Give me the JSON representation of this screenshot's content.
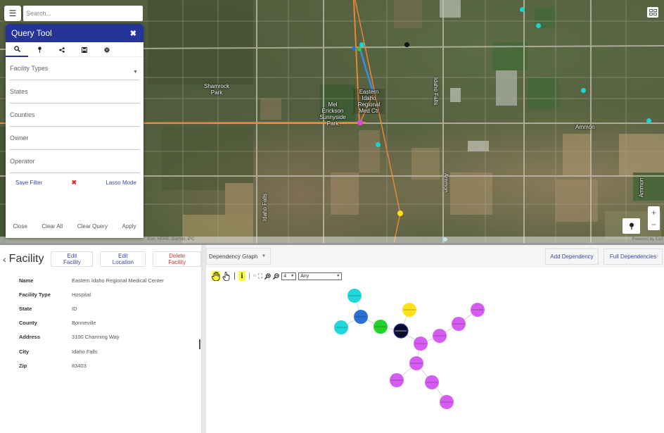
{
  "map": {
    "search_placeholder": "Search...",
    "labels": [
      {
        "id": "shamrock-park",
        "text": "Shamrock Park"
      },
      {
        "id": "mel-erickson-park",
        "text": "Mel Erickson Sunnyside Park"
      },
      {
        "id": "hospital-label",
        "text": "Eastern Idaho Regional Med Ctr"
      },
      {
        "id": "idaho-falls-1",
        "text": "Idaho Falls"
      },
      {
        "id": "idaho-falls-2",
        "text": "Idaho Falls"
      },
      {
        "id": "ammon-1",
        "text": "Ammon"
      },
      {
        "id": "ammon-2",
        "text": "Ammon"
      },
      {
        "id": "ammon-3",
        "text": "Ammon"
      }
    ],
    "attribution_left": "Esri, HERE, Garmin, iPC",
    "attribution_right": "Powered by Esri",
    "zoom_in": "+",
    "zoom_out": "−",
    "colors": {
      "route_orange": "#e8873a",
      "route_blue": "#3a8ee8",
      "marker_cyan": "#19d3d8",
      "marker_magenta": "#d44fe0",
      "marker_yellow": "#ffe11a"
    }
  },
  "query_tool": {
    "title": "Query Tool",
    "tabs": [
      {
        "name": "search",
        "icon": "search-icon"
      },
      {
        "name": "location",
        "icon": "pin-icon"
      },
      {
        "name": "share",
        "icon": "share-icon"
      },
      {
        "name": "save",
        "icon": "save-icon"
      },
      {
        "name": "settings",
        "icon": "gear-icon"
      }
    ],
    "fields": [
      {
        "label": "Facility Types",
        "has_dropdown": true
      },
      {
        "label": "States"
      },
      {
        "label": "Counties"
      },
      {
        "label": "Owner"
      },
      {
        "label": "Operator"
      }
    ],
    "save_filter": "Save Filter",
    "lasso_mode": "Lasso Mode",
    "footer": {
      "close": "Close",
      "clear_all": "Clear All",
      "clear_query": "Clear Query",
      "apply": "Apply"
    }
  },
  "facility": {
    "title": "Facility",
    "edit_facility": "Edit Facility",
    "edit_location": "Edit Location",
    "delete_facility": "Delete Facility",
    "rows": [
      {
        "key": "Name",
        "value": "Eastern Idaho Regional Medical Center"
      },
      {
        "key": "Facility Type",
        "value": "Hospital"
      },
      {
        "key": "State",
        "value": "ID"
      },
      {
        "key": "County",
        "value": "Bonneville"
      },
      {
        "key": "Address",
        "value": "3100 Channing Way"
      },
      {
        "key": "City",
        "value": "Idaho Falls"
      },
      {
        "key": "Zip",
        "value": "83403"
      }
    ]
  },
  "dependency": {
    "view_select": "Dependency Graph",
    "add_dependency": "Add Dependency",
    "full_dependencies": "Full Dependencies",
    "toolbar": {
      "depth_value": "4",
      "filter_value": "Any"
    },
    "graph": {
      "nodes": [
        {
          "id": "n1",
          "color": "#1ed8dc"
        },
        {
          "id": "n2",
          "color": "#2a6fd6"
        },
        {
          "id": "n3",
          "color": "#1ed8dc"
        },
        {
          "id": "n4",
          "color": "#27d12b"
        },
        {
          "id": "n5",
          "color": "#0a0a2a"
        },
        {
          "id": "n6",
          "color": "#ffe21c"
        },
        {
          "id": "n7",
          "color": "#d55cf0"
        },
        {
          "id": "n8",
          "color": "#d55cf0"
        },
        {
          "id": "n9",
          "color": "#d55cf0"
        },
        {
          "id": "n10",
          "color": "#d55cf0"
        },
        {
          "id": "n11",
          "color": "#d55cf0"
        },
        {
          "id": "n12",
          "color": "#d55cf0"
        },
        {
          "id": "n13",
          "color": "#d55cf0"
        },
        {
          "id": "n14",
          "color": "#d55cf0"
        }
      ],
      "edges": [
        [
          "n1",
          "n2"
        ],
        [
          "n3",
          "n2"
        ],
        [
          "n2",
          "n4"
        ],
        [
          "n4",
          "n5"
        ],
        [
          "n6",
          "n5"
        ],
        [
          "n5",
          "n7"
        ],
        [
          "n7",
          "n8"
        ],
        [
          "n8",
          "n9"
        ],
        [
          "n9",
          "n10"
        ],
        [
          "n7",
          "n11"
        ],
        [
          "n11",
          "n12"
        ],
        [
          "n11",
          "n13"
        ],
        [
          "n13",
          "n14"
        ]
      ]
    }
  }
}
